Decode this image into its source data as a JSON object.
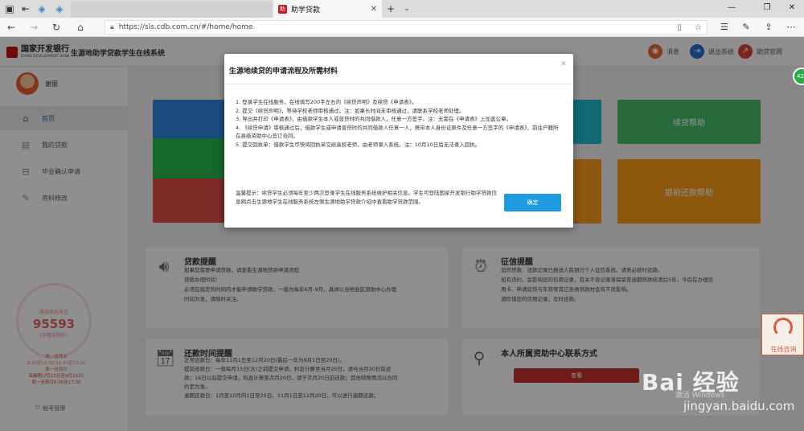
{
  "browser": {
    "tab_title": "助学贷款",
    "url": "https://sls.cdb.com.cn/#/home/home"
  },
  "header": {
    "bank_name": "国家开发银行",
    "bank_name_en": "CHINA DEVELOPMENT BANK",
    "system_title": "生源地助学贷款学生在线系统",
    "buttons": [
      {
        "label": "消息",
        "color": "#e0642f",
        "icon": "bell-icon"
      },
      {
        "label": "退出系统",
        "color": "#2a6dc9",
        "icon": "logout-icon"
      },
      {
        "label": "助贷官网",
        "color": "#d8403a",
        "icon": "link-icon"
      }
    ]
  },
  "sidebar": {
    "username": "谢丽",
    "items": [
      {
        "label": "首页",
        "icon": "home-icon",
        "active": true
      },
      {
        "label": "我的贷款",
        "icon": "list-icon",
        "active": false
      },
      {
        "label": "毕业确认申请",
        "icon": "inbox-icon",
        "active": false
      },
      {
        "label": "资料修改",
        "icon": "edit-icon",
        "active": false
      }
    ],
    "hotline_label": "服务热线电话",
    "hotline_number": "95593",
    "hotline_sub": "(节假日除外)",
    "hours": [
      "周一至周五",
      "8:30至11:30 13:30至17:30",
      "周一至周日",
      "高峰期(7月15日至9月15日)",
      "周一至周日8:30至17:30"
    ],
    "account": "帐号管理"
  },
  "tiles": [
    {
      "label": "",
      "color": "#2d82d8"
    },
    {
      "label": "",
      "color": "#28b44a"
    },
    {
      "label": "",
      "color": "#d84a47"
    },
    {
      "label": "",
      "color": "#1cb6c8"
    },
    {
      "label": "续贷帮助",
      "color": "#44b86a"
    },
    {
      "label": "",
      "color": "#f0961e"
    },
    {
      "label": "提前还款帮助",
      "color": "#f29818"
    }
  ],
  "panels": {
    "loan_tip": {
      "title": "贷款提醒",
      "lines": [
        "如果您需要申请贷款，请查看生源地贷款申请流程",
        "贷款办理时间：",
        "必须在指定的时间内才能申请助学贷款，一般为每年6月-9月，具体以当地县区资助中心办理",
        "时间为准，请随时关注。"
      ]
    },
    "credit_tip": {
      "title": "征信提醒",
      "lines": [
        "您的贷款、还款记录已报送人民银行个人征信系统，请务必按时还款。",
        "如有违约，会影响您的信用记录，有关不良记录将保留至逾期贷款结清后5年，今后在办理信",
        "用卡、申请房贷与车贷等其它各类贷款时会有不良影响。",
        "请珍惜您的信用记录，及时还款。"
      ]
    },
    "repay_tip": {
      "title": "还款时间提醒",
      "lines": [
        "正常还款日：每年11月1日至12月20日(最后一年为9月1日至20日)。",
        "提前还款日：一般每月15日(含)之前提交申请，利息计算至当月20日，请与当月20日前还",
        "款；16日以后提交申请，利息计算至次月20日，请于次月20日前还款；其他特殊情况以合同",
        "约定为准。",
        "逾期还款日：1月至10月的1日至20日、11月1日至12月20日，可以进行逾期还款。"
      ]
    },
    "center_tip": {
      "title": "本人所属资助中心联系方式",
      "button": "查看"
    }
  },
  "modal": {
    "title": "生源地续贷的申请流程及所需材料",
    "steps": [
      "1. 登录学生在线服务，在线填写200字左右的《续贷声明》及续贷《申请表》。",
      "2. 提交《续贷声明》，等待学校老师审核通过。注：如果长时间未审核通过，请联系学校老师处理。",
      "3. 导出并打印《申请表》，由借款学生本人或普贷时的共同借款人，任意一方签字。注：无需在《申请表》上加盖公章。",
      "4. 《续贷申请》审核通过后，借款学生或申请普贷时的共同借款人任意一人，携带本人身份证原件及任意一方签字的《申请表》，前往户籍所在县级资助中心签订合同。",
      "5. 提交回执单：借款学生尽快将回执单交给高校老师，由老师录入系统。注：10月10日后无法录入回执。"
    ],
    "tip": "温馨提示：续贷学生必须每年至少两次登录学生在线服务系统维护相关信息。学生可登陆国家开发银行助学贷款信息网点击生源地学生在线服务系统左侧生源地助学贷款介绍中查看助学贷款范围。",
    "confirm": "确定"
  },
  "floating": {
    "badge": "42",
    "consult": "在线咨询"
  },
  "watermark": {
    "logo": "Bai 经验",
    "win": "激活 Windows",
    "url": "jingyan.baidu.com"
  }
}
